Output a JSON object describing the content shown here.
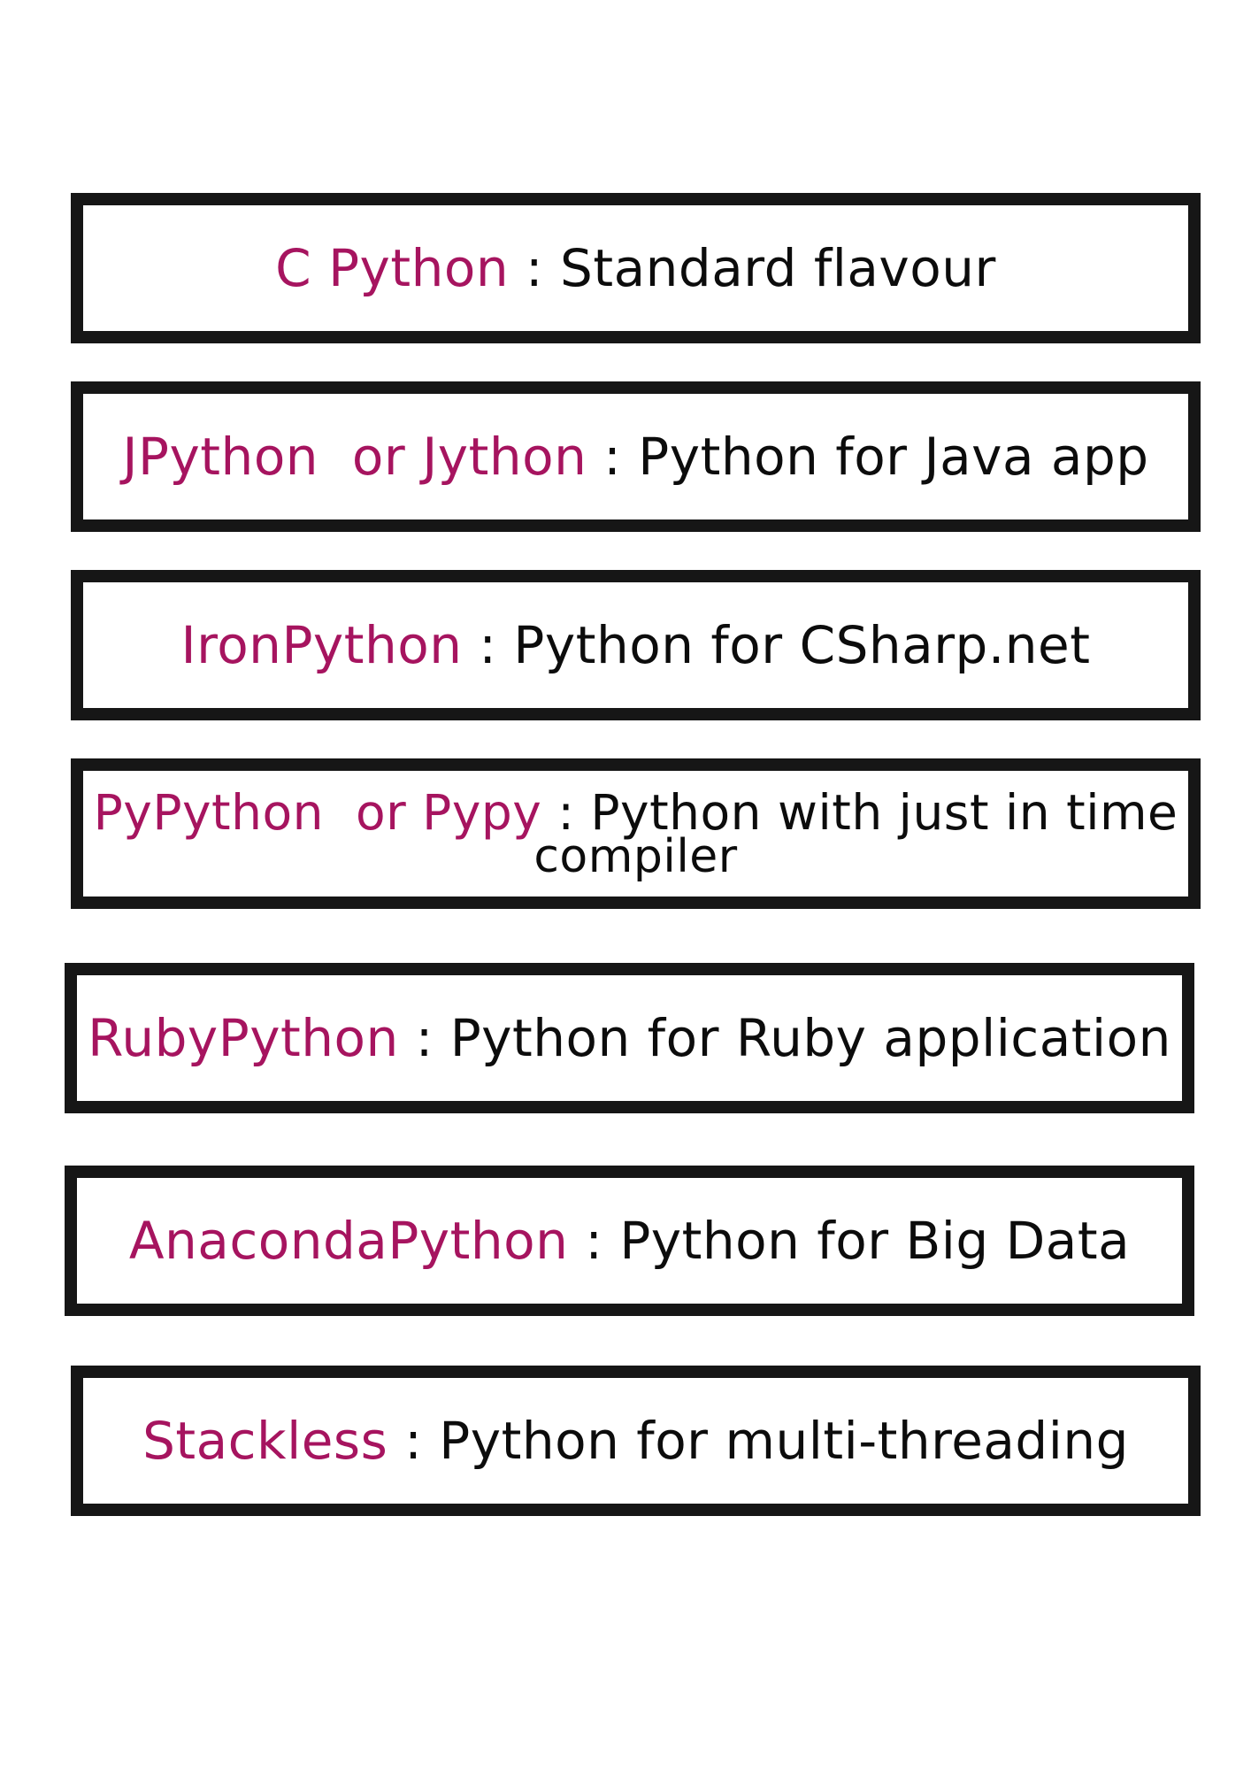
{
  "cards": [
    {
      "name": "C Python",
      "sep": " : ",
      "desc": "Standard flavour"
    },
    {
      "name": "JPython  or Jython",
      "sep": " : ",
      "desc": "Python for Java app"
    },
    {
      "name": "IronPython",
      "sep": " : ",
      "desc": "Python for CSharp.net"
    },
    {
      "name": "PyPython  or Pypy",
      "sep": " : ",
      "desc": "Python with just in time",
      "desc_wrap": "compiler"
    },
    {
      "name": "RubyPython",
      "sep": " : ",
      "desc": "Python for Ruby application"
    },
    {
      "name": "AnacondaPython",
      "sep": " : ",
      "desc": "Python for Big Data"
    },
    {
      "name": "Stackless",
      "sep": " : ",
      "desc": "Python for multi-threading"
    }
  ],
  "colors": {
    "name": "#a6145f",
    "text": "#0c0c0c",
    "border": "#161616",
    "background": "#ffffff"
  }
}
